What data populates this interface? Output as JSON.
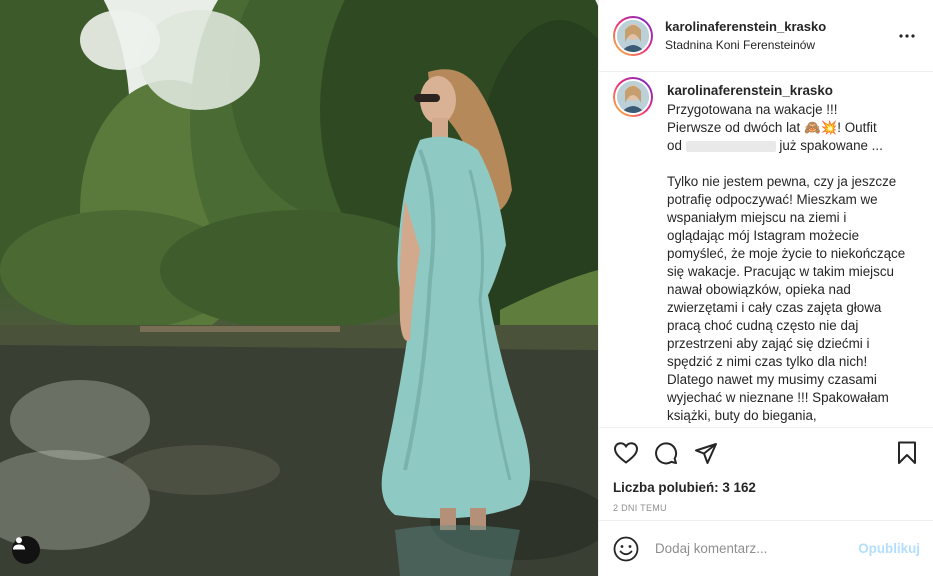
{
  "post": {
    "username": "karolinaferenstein_krasko",
    "location": "Stadnina Koni Ferensteinów",
    "caption": {
      "username": "karolinaferenstein_krasko",
      "line1": "Przygotowana na wakacje !!!",
      "line2": "Pierwsze od dwóch lat 🙈💥! Outfit",
      "line3_prefix": "od",
      "line3_suffix": "już spakowane ...",
      "paragraph2": "Tylko nie jestem pewna, czy ja jeszcze potrafię odpoczywać! Mieszkam we wspaniałym miejscu na ziemi i oglądając mój Istagram możecie pomyśleć, że moje życie to niekończące się wakacje. Pracując w takim miejscu nawał obowiązków, opieka nad zwierzętami i cały czas zajęta głowa pracą choć cudną często nie daj przestrzeni aby zająć się dziećmi i spędzić z nimi czas tylko dla nich! Dlatego nawet my musimy czasami wyjechać w nieznane !!! Spakowałam książki, buty do biegania,"
    },
    "likes": "Liczba polubień: 3 162",
    "time": "2 DNI TEMU"
  },
  "comment": {
    "placeholder": "Dodaj komentarz...",
    "post_label": "Opublikuj"
  },
  "icons": {
    "more": "more-options-icon",
    "like": "heart-icon",
    "comment": "comment-icon",
    "share": "paper-plane-icon",
    "save": "bookmark-icon",
    "emoji": "emoji-icon",
    "tag": "user-tag-icon"
  },
  "colors": {
    "accent": "#0095f6",
    "post_disabled": "#b2dffc",
    "muted": "#8e8e8e",
    "text": "#262626"
  }
}
